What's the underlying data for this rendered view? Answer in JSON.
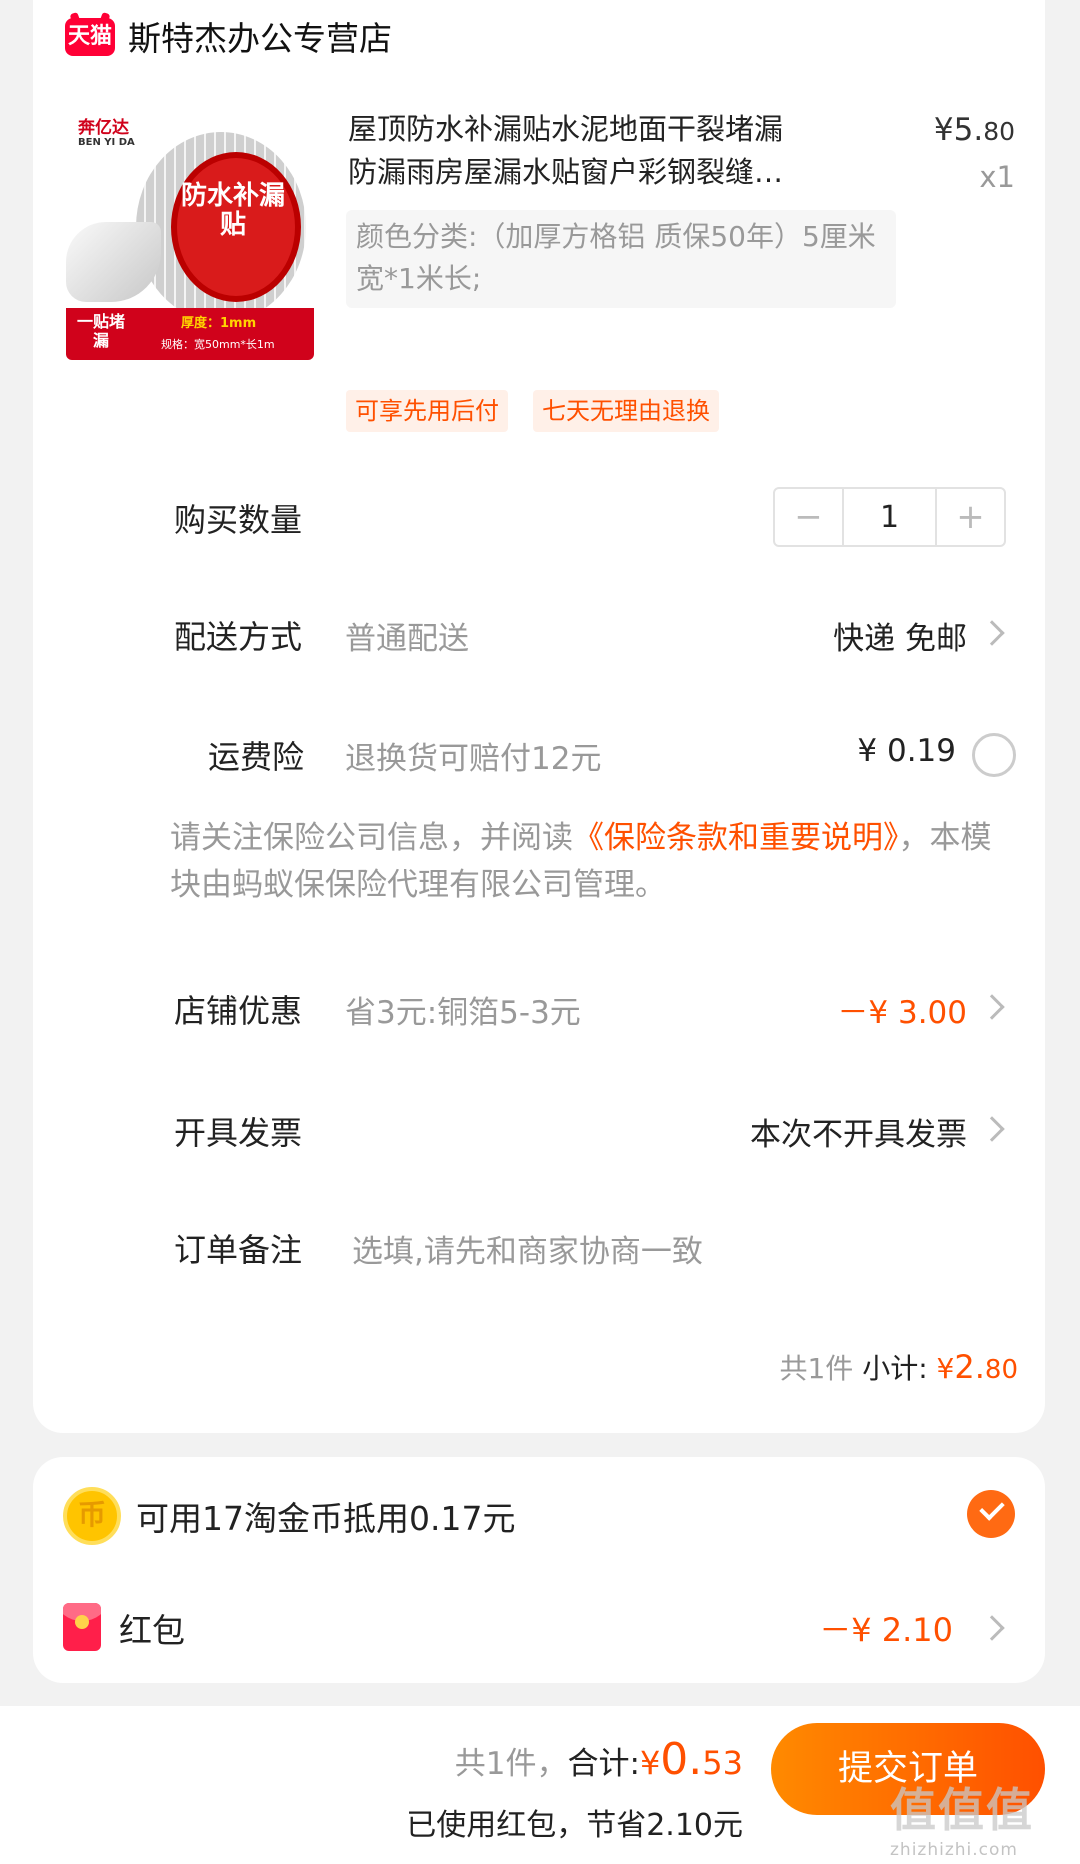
{
  "shop": {
    "logo_text": "天猫",
    "name": "斯特杰办公专营店"
  },
  "product": {
    "image": {
      "brand": "奔亿达",
      "brand_en": "BEN YI DA",
      "title": "防水补漏贴",
      "badge": "一贴堵漏",
      "thickness": "厚度：1mm",
      "spec": "规格：宽50mm*长1m"
    },
    "title": "屋顶防水补漏贴水泥地面干裂堵漏防漏雨房屋漏水贴窗户彩钢裂缝墙角…",
    "price_int": "¥5.",
    "price_dec": "80",
    "qty": "x1",
    "sku": "颜色分类:（加厚方格铝 质保50年）5厘米宽*1米长;",
    "tags": [
      "可享先用后付",
      "七天无理由退换"
    ]
  },
  "quantity": {
    "label": "购买数量",
    "minus": "−",
    "value": "1",
    "plus": "+"
  },
  "delivery": {
    "label": "配送方式",
    "sub": "普通配送",
    "value": "快递 免邮"
  },
  "insurance": {
    "label": "运费险",
    "sub": "退换货可赔付12元",
    "value": "¥ 0.19",
    "note_prefix": "请关注保险公司信息，并阅读",
    "note_link": "《保险条款和重要说明》",
    "note_suffix": "，本模块由蚂蚁保保险代理有限公司管理。"
  },
  "shop_discount": {
    "label": "店铺优惠",
    "sub": "省3元:铜箔5-3元",
    "value": "－¥ 3.00"
  },
  "invoice": {
    "label": "开具发票",
    "value": "本次不开具发票"
  },
  "remark": {
    "label": "订单备注",
    "placeholder": "选填,请先和商家协商一致"
  },
  "subtotal": {
    "count": "共1件",
    "label": "小计:",
    "currency": "¥",
    "int": "2.",
    "dec": "80"
  },
  "coins": {
    "icon_text": "币",
    "text": "可用17淘金币抵用0.17元",
    "checked": true
  },
  "red_packet": {
    "label": "红包",
    "value": "－¥ 2.10"
  },
  "bottom": {
    "count": "共1件，",
    "total_label": "合计:",
    "currency": "¥",
    "total_int": "0.",
    "total_dec": "53",
    "saved": "已使用红包，节省2.10元",
    "submit": "提交订单"
  },
  "watermark": {
    "main": "值值值",
    "sub": "zhizhizhi.com"
  },
  "colors": {
    "accent": "#ff5000",
    "tmall_red": "#ff0036",
    "muted": "#999999",
    "background": "#f2f2f2"
  }
}
